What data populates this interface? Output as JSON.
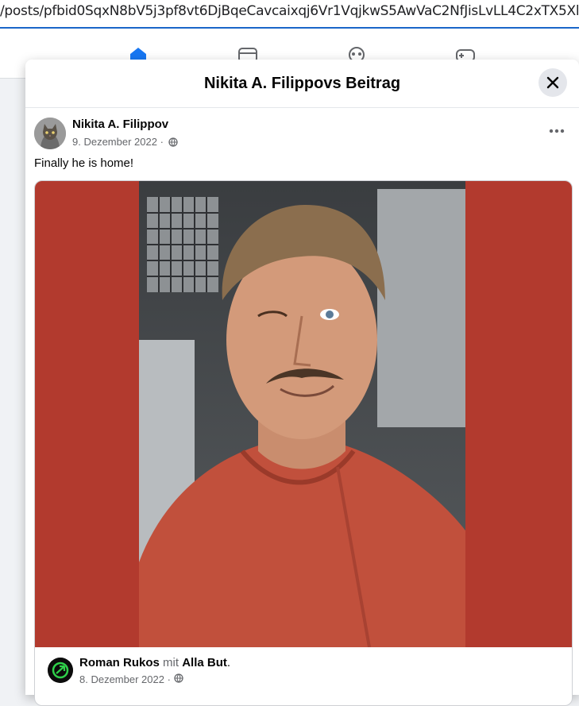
{
  "browser": {
    "url": "/posts/pfbid0SqxN8bV5j3pf8vt6DjBqeCavcaixqj6Vr1VqjkwS5AwVaC2NfJisLvLL4C2xTX5Xl"
  },
  "topnav": {
    "icons": [
      "home-icon",
      "watch-icon",
      "groups-icon",
      "gaming-icon"
    ],
    "active_color": "#1877f2"
  },
  "modal": {
    "title": "Nikita A. Filippovs Beitrag",
    "close_icon": "close-icon"
  },
  "post": {
    "author": "Nikita A. Filippov",
    "date": "9. Dezember 2022",
    "separator": "·",
    "privacy_icon": "globe-icon",
    "text": "Finally he is home!",
    "more_icon": "more-icon"
  },
  "shared_post": {
    "author": "Roman Rukos",
    "with_word": "mit",
    "tagged": "Alla But",
    "tagged_suffix": ".",
    "date": "8. Dezember 2022",
    "separator": "·",
    "background_color": "#b23a2e"
  }
}
